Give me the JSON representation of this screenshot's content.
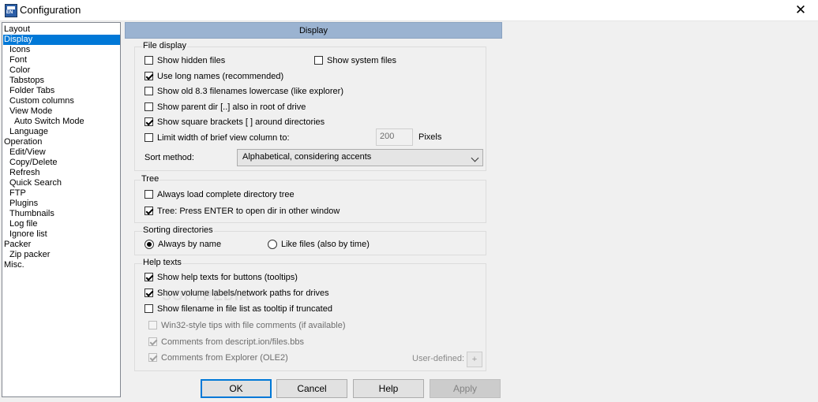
{
  "window": {
    "title": "Configuration",
    "close_glyph": "✕"
  },
  "tree": [
    {
      "label": "Layout",
      "indent": 0
    },
    {
      "label": "Display",
      "indent": 0,
      "selected": true
    },
    {
      "label": "Icons",
      "indent": 1
    },
    {
      "label": "Font",
      "indent": 1
    },
    {
      "label": "Color",
      "indent": 1
    },
    {
      "label": "Tabstops",
      "indent": 1
    },
    {
      "label": "Folder Tabs",
      "indent": 1
    },
    {
      "label": "Custom columns",
      "indent": 1
    },
    {
      "label": "View Mode",
      "indent": 1
    },
    {
      "label": "Auto Switch Mode",
      "indent": 2
    },
    {
      "label": "Language",
      "indent": 1
    },
    {
      "label": "Operation",
      "indent": 0
    },
    {
      "label": "Edit/View",
      "indent": 1
    },
    {
      "label": "Copy/Delete",
      "indent": 1
    },
    {
      "label": "Refresh",
      "indent": 1
    },
    {
      "label": "Quick Search",
      "indent": 1
    },
    {
      "label": "FTP",
      "indent": 1
    },
    {
      "label": "Plugins",
      "indent": 1
    },
    {
      "label": "Thumbnails",
      "indent": 1
    },
    {
      "label": "Log file",
      "indent": 1
    },
    {
      "label": "Ignore list",
      "indent": 1
    },
    {
      "label": "Packer",
      "indent": 0
    },
    {
      "label": "Zip packer",
      "indent": 1
    },
    {
      "label": "Misc.",
      "indent": 0
    }
  ],
  "panel": {
    "title": "Display"
  },
  "file_display": {
    "title": "File display",
    "show_hidden": {
      "label": "Show hidden files",
      "checked": false
    },
    "show_system": {
      "label": "Show system files",
      "checked": false
    },
    "long_names": {
      "label": "Use long names (recommended)",
      "checked": true
    },
    "old83": {
      "label": "Show old 8.3 filenames lowercase (like explorer)",
      "checked": false
    },
    "parent_dir": {
      "label": "Show parent dir [..] also in root of drive",
      "checked": false
    },
    "square_brackets": {
      "label": "Show square brackets [ ] around directories",
      "checked": true
    },
    "limit_width": {
      "label": "Limit width of brief view column to:",
      "checked": false
    },
    "width_value": "200",
    "width_unit": "Pixels",
    "sort_label": "Sort method:",
    "sort_value": "Alphabetical, considering accents"
  },
  "tree_group": {
    "title": "Tree",
    "always_load": {
      "label": "Always load complete directory tree",
      "checked": false
    },
    "enter_open": {
      "label": "Tree: Press ENTER to open dir in other window",
      "checked": true
    }
  },
  "sorting": {
    "title": "Sorting directories",
    "by_name": {
      "label": "Always by name",
      "selected": true
    },
    "like_files": {
      "label": "Like files (also by time)",
      "selected": false
    }
  },
  "help": {
    "title": "Help texts",
    "tooltips": {
      "label": "Show help texts for buttons (tooltips)",
      "checked": true
    },
    "volume_labels": {
      "label": "Show volume labels/network paths for drives",
      "checked": true
    },
    "filename_tooltip": {
      "label": "Show filename in file list as tooltip if truncated",
      "checked": false
    },
    "win32_tips": {
      "label": "Win32-style tips with file comments (if available)",
      "checked": false
    },
    "descript": {
      "label": "Comments from descript.ion/files.bbs",
      "checked": true
    },
    "explorer": {
      "label": "Comments from Explorer (OLE2)",
      "checked": true
    },
    "user_defined": "User-defined:",
    "plus": "+"
  },
  "buttons": {
    "ok": "OK",
    "cancel": "Cancel",
    "help": "Help",
    "apply": "Apply"
  },
  "watermark": "SOFTPEDIA"
}
